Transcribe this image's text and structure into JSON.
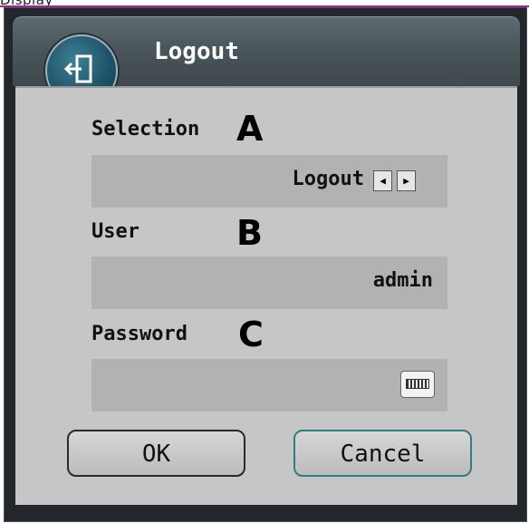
{
  "top": {
    "text": "Display"
  },
  "dialog": {
    "title": "Logout",
    "icon": "logout-door-icon"
  },
  "fields": {
    "selection": {
      "label": "Selection",
      "marker": "A",
      "value": "Logout"
    },
    "user": {
      "label": "User",
      "marker": "B",
      "value": "admin"
    },
    "password": {
      "label": "Password",
      "marker": "C",
      "value": ""
    }
  },
  "buttons": {
    "ok": "OK",
    "cancel": "Cancel"
  },
  "colors": {
    "panel": "#c6c6c6",
    "field": "#b2b2b2",
    "frame": "#23272c",
    "cancel_border": "#2f7f7a"
  }
}
